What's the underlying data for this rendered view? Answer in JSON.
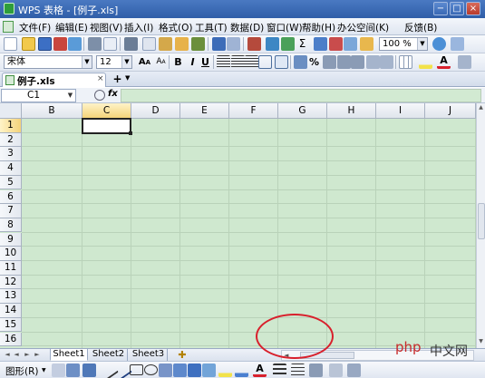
{
  "window": {
    "title": "WPS 表格 - [例子.xls]",
    "controls": [
      "−",
      "□",
      "×"
    ]
  },
  "menu": [
    "文件(F)",
    "编辑(E)",
    "视图(V)",
    "插入(I)",
    "格式(O)",
    "工具(T)",
    "数据(D)",
    "窗口(W)",
    "帮助(H)",
    "办公空间(K)",
    "反馈(B)"
  ],
  "toolbar": {
    "zoom": "100 %",
    "sigma": "Σ"
  },
  "format": {
    "font": "宋体",
    "size": "12",
    "bold": "B",
    "italic": "I",
    "underline": "U",
    "percent": "%"
  },
  "tab": {
    "doc_name": "例子.xls",
    "add": "+"
  },
  "formula_bar": {
    "cell_ref": "C1",
    "fx": "fx",
    "value": ""
  },
  "sheet": {
    "columns": [
      "B",
      "C",
      "D",
      "E",
      "F",
      "G",
      "H",
      "I",
      "J"
    ],
    "rows": [
      "1",
      "2",
      "3",
      "4",
      "5",
      "6",
      "7",
      "8",
      "9",
      "10",
      "11",
      "12",
      "13",
      "14",
      "15",
      "16"
    ],
    "active_cell": "C1"
  },
  "sheet_tabs": {
    "tabs": [
      "Sheet1",
      "Sheet2",
      "Sheet3"
    ],
    "active": "Sheet1"
  },
  "draw": {
    "label": "图形(R)"
  },
  "watermark": {
    "logo": "php",
    "text": "中文网"
  },
  "colors": {
    "grid_bg": "#cfe8cf",
    "title_bg": "#2f5ea8",
    "annotation": "#d8202c"
  }
}
